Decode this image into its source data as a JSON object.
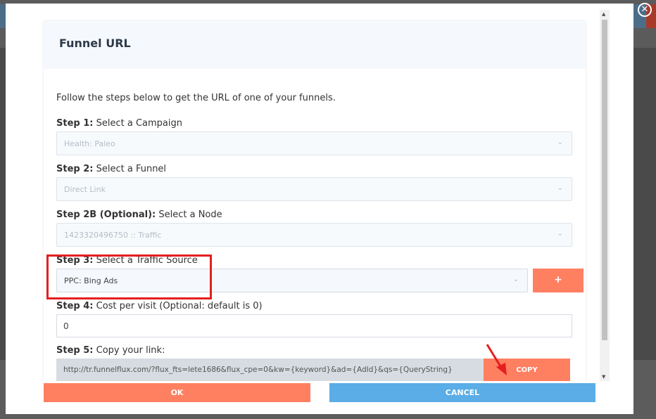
{
  "modal": {
    "title": "Funnel URL",
    "intro": "Follow the steps below to get the URL of one of your funnels.",
    "close_icon": "close-icon"
  },
  "steps": {
    "step1": {
      "num": "Step 1:",
      "label": " Select a Campaign",
      "value": "Health: Paleo"
    },
    "step2": {
      "num": "Step 2:",
      "label": " Select a Funnel",
      "value": "Direct Link"
    },
    "step2b": {
      "num": "Step 2B (Optional):",
      "label": " Select a Node",
      "value": "1423320496750 :: Traffic"
    },
    "step3": {
      "num": "Step 3:",
      "label": " Select a Traffic Source",
      "value": "PPC: Bing Ads",
      "add_label": "+"
    },
    "step4": {
      "num": "Step 4:",
      "label": " Cost per visit (Optional: default is 0)",
      "value": "0"
    },
    "step5": {
      "num": "Step 5:",
      "label": " Copy your link:",
      "url": "http://tr.funnelflux.com/?flux_fts=lete1686&flux_cpe=0&kw={keyword}&ad={AdId}&qs={QueryString}",
      "copy_label": "COPY"
    }
  },
  "footer": {
    "ok_label": "OK",
    "cancel_label": "CANCEL"
  },
  "colors": {
    "accent": "#ff7f61",
    "cancel": "#5aade6",
    "highlight": "#e61e1e"
  }
}
